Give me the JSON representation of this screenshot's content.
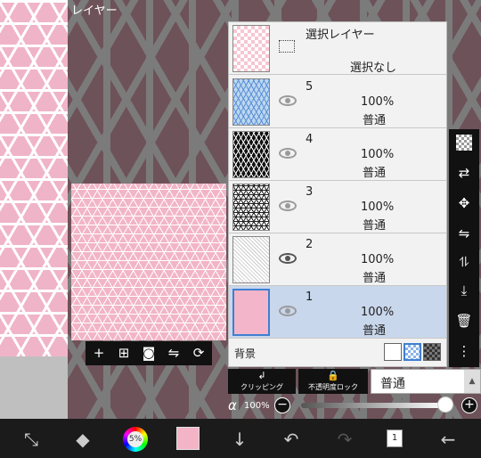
{
  "title": "レイヤー",
  "selection_layer": {
    "name": "選択レイヤー",
    "status": "選択なし"
  },
  "layers": [
    {
      "name": "5",
      "opacity": "100%",
      "blend": "普通",
      "visible": true
    },
    {
      "name": "4",
      "opacity": "100%",
      "blend": "普通",
      "visible": true
    },
    {
      "name": "3",
      "opacity": "100%",
      "blend": "普通",
      "visible": true
    },
    {
      "name": "2",
      "opacity": "100%",
      "blend": "普通",
      "visible": true
    },
    {
      "name": "1",
      "opacity": "100%",
      "blend": "普通",
      "visible": true,
      "selected": true
    }
  ],
  "background": {
    "label": "背景",
    "options": [
      "white",
      "checker-blue",
      "checker-dark"
    ],
    "selected": "checker-blue"
  },
  "controls": {
    "clipping_label": "クリッピング",
    "lock_alpha_label": "不透明度ロック",
    "blend_mode": "普通",
    "alpha_symbol": "α",
    "alpha_value": "100%",
    "alpha_level": 1.0
  },
  "colors": {
    "primary": "#f4b4c8",
    "selection": "#c9d7ec",
    "toolbar": "#111111"
  },
  "right_toolbar_icons": [
    "checker-icon",
    "move-layer-icon",
    "transform-icon",
    "flip-horizontal-icon",
    "flip-vertical-icon",
    "merge-down-icon",
    "trash-icon",
    "more-icon"
  ],
  "floating_toolbar_icons": [
    "add-layer-icon",
    "add-layer-box-icon",
    "camera-icon",
    "flip-icon",
    "rotate-icon"
  ],
  "bottom_bar": {
    "color_wheel_label": "5%",
    "layer_count": "1",
    "icons": [
      "transform-tool-icon",
      "fill-tool-icon",
      "color-wheel-icon",
      "color-swatch",
      "down-arrow-icon",
      "undo-icon",
      "redo-icon",
      "layers-icon",
      "back-icon"
    ]
  }
}
